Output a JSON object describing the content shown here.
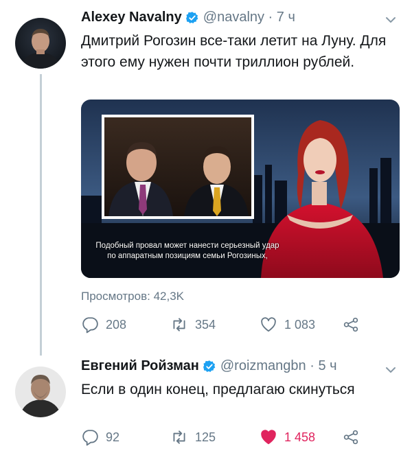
{
  "tweets": [
    {
      "author": "Alexey Navalny",
      "handle": "@navalny · 7 ч",
      "text": "Дмитрий Рогозин все-таки летит на Луну. Для этого ему нужен почти триллион рублей.",
      "media_caption_line1": "Подобный провал может нанести серьезный удар",
      "media_caption_line2": "по аппаратным позициям семьи Рогозиных,",
      "views": "Просмотров: 42,3K",
      "replies": "208",
      "retweets": "354",
      "likes": "1 083",
      "liked": false
    },
    {
      "author": "Евгений Ройзман",
      "handle": "@roizmangbn · 5 ч",
      "text": "Если в один конец, предлагаю скинуться",
      "replies": "92",
      "retweets": "125",
      "likes": "1 458",
      "liked": true
    }
  ],
  "colors": {
    "verified": "#1da1f2",
    "muted": "#657786",
    "like_active": "#e0245e",
    "thread_line": "#c4cfd6"
  },
  "icons": [
    "verified-icon",
    "caret-down-icon",
    "reply-icon",
    "retweet-icon",
    "like-icon",
    "share-icon"
  ]
}
